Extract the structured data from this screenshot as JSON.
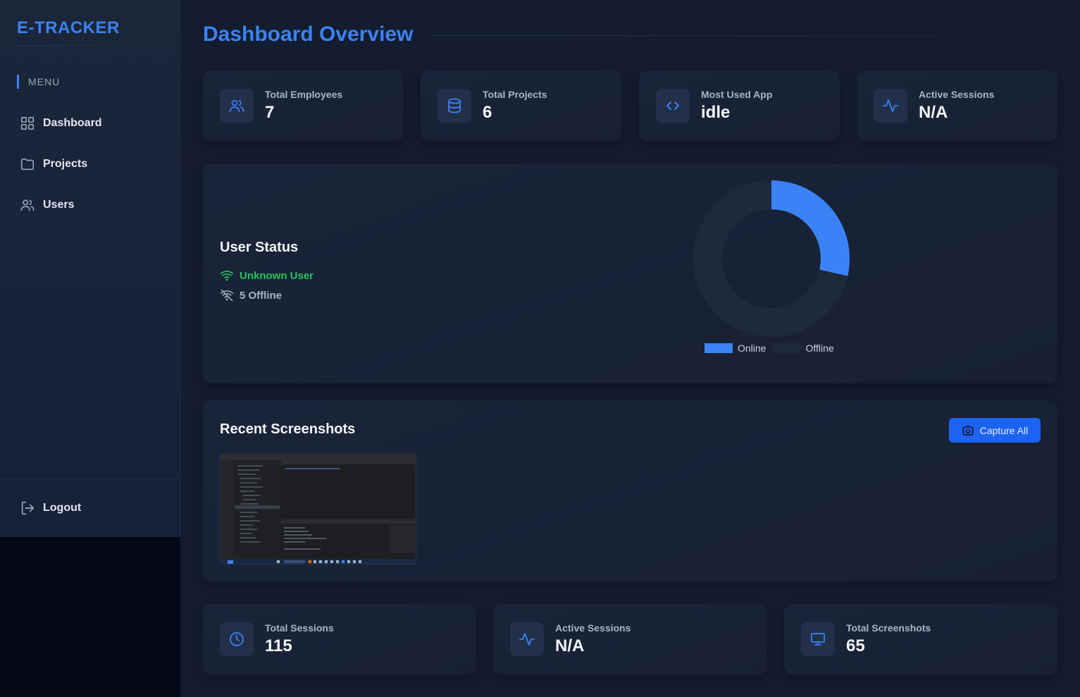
{
  "brand": "E-TRACKER",
  "sidebar": {
    "menu_label": "MENU",
    "items": [
      {
        "label": "Dashboard",
        "icon": "grid-icon"
      },
      {
        "label": "Projects",
        "icon": "folder-icon"
      },
      {
        "label": "Users",
        "icon": "users-icon"
      }
    ],
    "logout_label": "Logout"
  },
  "page_title": "Dashboard Overview",
  "top_stats": [
    {
      "label": "Total Employees",
      "value": "7",
      "icon": "users-icon"
    },
    {
      "label": "Total Projects",
      "value": "6",
      "icon": "database-icon"
    },
    {
      "label": "Most Used App",
      "value": "idle",
      "icon": "code-icon"
    },
    {
      "label": "Active Sessions",
      "value": "N/A",
      "icon": "activity-icon"
    }
  ],
  "user_status": {
    "title": "User Status",
    "online_text": "Unknown User",
    "offline_text": "5 Offline",
    "legend_online": "Online",
    "legend_offline": "Offline"
  },
  "chart_data": {
    "type": "pie",
    "categories": [
      "Online",
      "Offline"
    ],
    "values": [
      2,
      5
    ],
    "colors": [
      "#3b82f6",
      "#1e293b"
    ],
    "legend": "bottom"
  },
  "screenshots": {
    "title": "Recent Screenshots",
    "capture_label": "Capture All"
  },
  "bottom_stats": [
    {
      "label": "Total Sessions",
      "value": "115",
      "icon": "clock-icon"
    },
    {
      "label": "Active Sessions",
      "value": "N/A",
      "icon": "activity-icon"
    },
    {
      "label": "Total Screenshots",
      "value": "65",
      "icon": "monitor-icon"
    }
  ],
  "colors": {
    "accent": "#3b82f6",
    "online": "#22c55e",
    "button": "#1d63f2"
  }
}
